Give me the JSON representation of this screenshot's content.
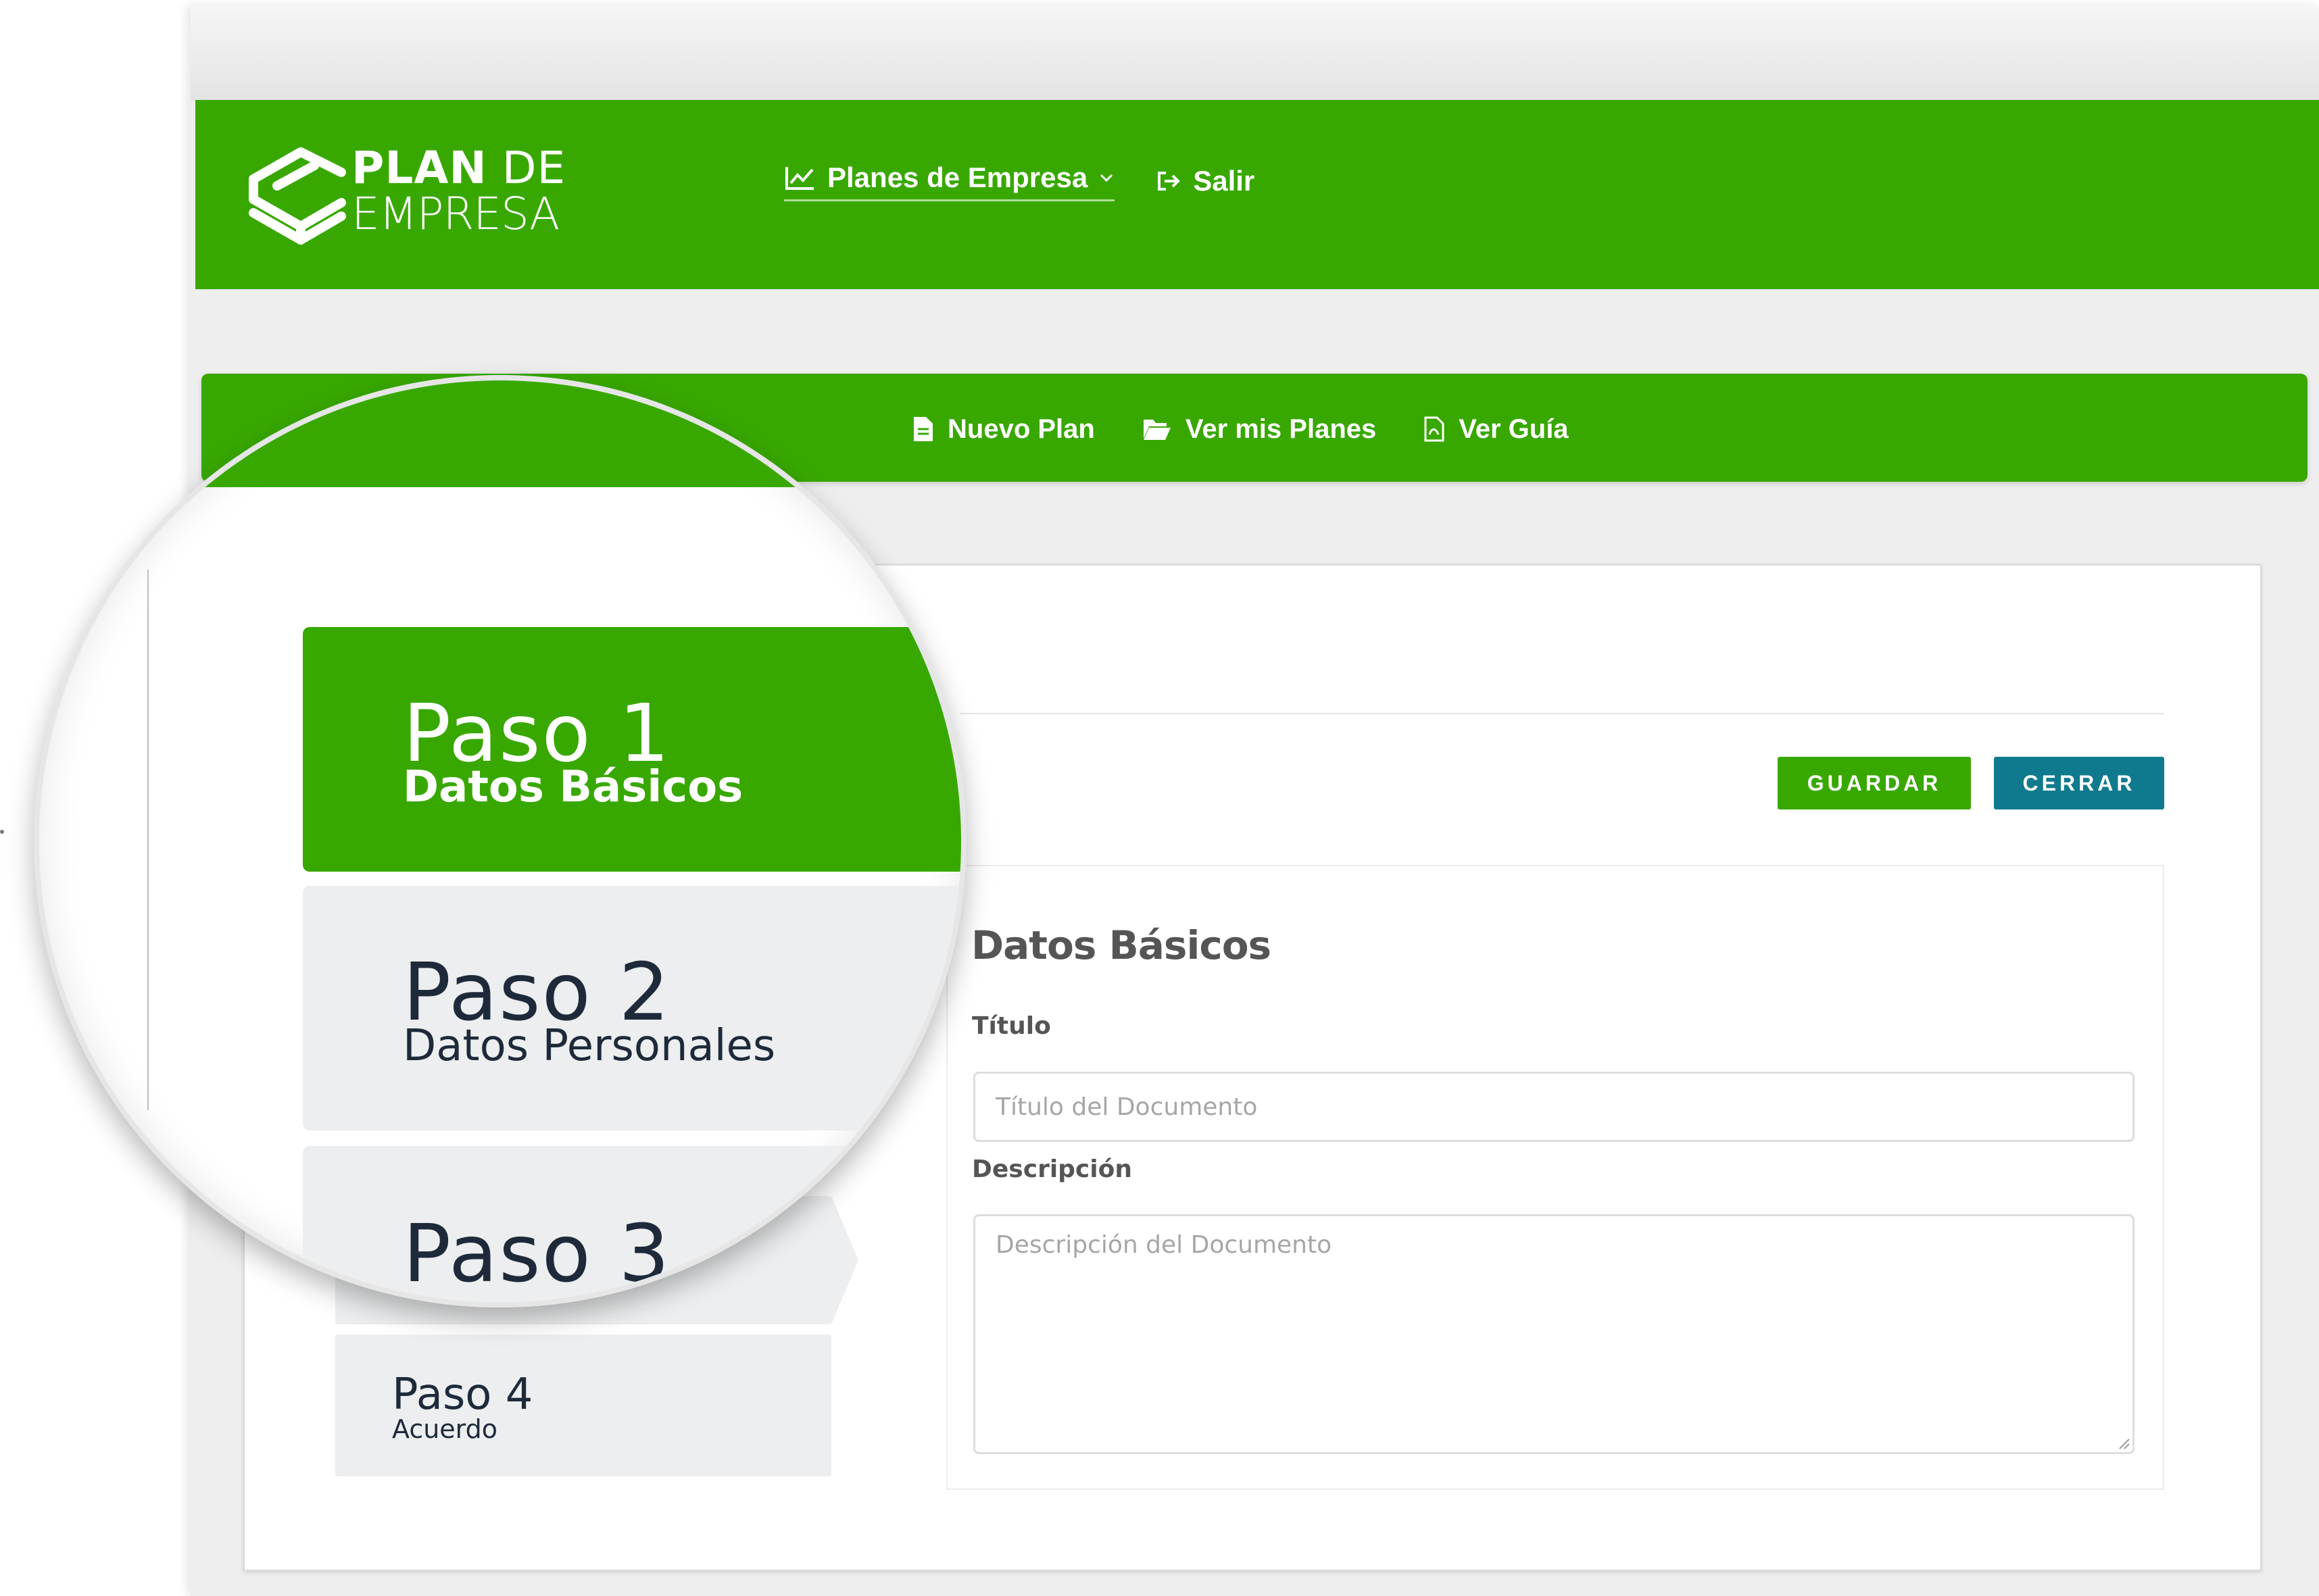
{
  "header": {
    "logo_line1_bold": "PLAN",
    "logo_line1_light": " DE",
    "logo_line2": "EMPRESA",
    "nav_planes": "Planes de Empresa",
    "nav_salir": "Salir"
  },
  "subnav": {
    "nuevo_plan": "Nuevo Plan",
    "ver_mis_planes": "Ver mis Planes",
    "ver_guia": "Ver Guía"
  },
  "steps": [
    {
      "num": "Paso 1",
      "label": "Datos Básicos",
      "active": true
    },
    {
      "num": "Paso 2",
      "label": "Datos Personales",
      "active": false
    },
    {
      "num": "Paso 3",
      "label": "",
      "active": false
    },
    {
      "num": "Paso 4",
      "label": "Acuerdo",
      "active": false
    }
  ],
  "actions": {
    "guardar": "GUARDAR",
    "cerrar": "CERRAR"
  },
  "form": {
    "title": "Datos Básicos",
    "titulo_label": "Título",
    "titulo_placeholder": "Título del Documento",
    "descripcion_label": "Descripción",
    "descripcion_placeholder": "Descripción del Documento"
  },
  "colors": {
    "brand_green": "#38a800",
    "cerrar_teal": "#0f7a8e",
    "step_inactive": "#eceeef",
    "background": "#eeeeee"
  },
  "icons": [
    "cube-logo-icon",
    "line-chart-icon",
    "chevron-down-icon",
    "sign-out-icon",
    "file-icon",
    "folder-open-icon",
    "file-pdf-icon",
    "resize-grip-icon"
  ]
}
